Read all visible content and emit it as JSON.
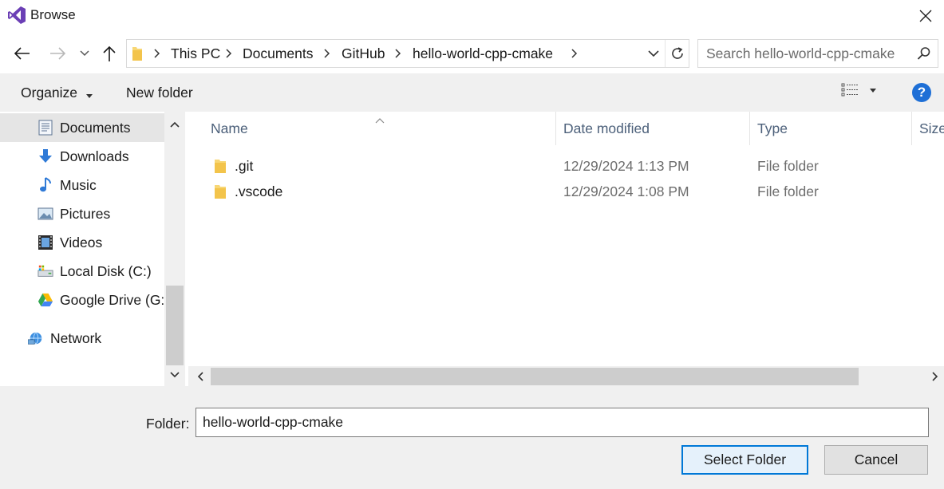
{
  "window": {
    "title": "Browse",
    "icon": "visual-studio-icon"
  },
  "address": {
    "crumbs": [
      "This PC",
      "Documents",
      "GitHub",
      "hello-world-cpp-cmake"
    ]
  },
  "search": {
    "placeholder": "Search hello-world-cpp-cmake"
  },
  "toolbar": {
    "organize_label": "Organize",
    "new_folder_label": "New folder",
    "help_label": "?"
  },
  "nav": {
    "items": [
      {
        "label": "Documents",
        "icon": "documents-icon"
      },
      {
        "label": "Downloads",
        "icon": "downloads-icon"
      },
      {
        "label": "Music",
        "icon": "music-icon"
      },
      {
        "label": "Pictures",
        "icon": "pictures-icon"
      },
      {
        "label": "Videos",
        "icon": "videos-icon"
      },
      {
        "label": "Local Disk (C:)",
        "icon": "local-disk-icon"
      },
      {
        "label": "Google Drive (G:",
        "icon": "google-drive-icon"
      },
      {
        "label": "Network",
        "icon": "network-icon"
      }
    ]
  },
  "list": {
    "columns": {
      "name": "Name",
      "date": "Date modified",
      "type": "Type",
      "size": "Size"
    },
    "rows": [
      {
        "name": ".git",
        "date": "12/29/2024 1:13 PM",
        "type": "File folder"
      },
      {
        "name": ".vscode",
        "date": "12/29/2024 1:08 PM",
        "type": "File folder"
      }
    ]
  },
  "footer": {
    "folder_label": "Folder:",
    "folder_value": "hello-world-cpp-cmake",
    "select_label": "Select Folder",
    "cancel_label": "Cancel"
  },
  "colors": {
    "accent": "#0078d7",
    "folder": "#f8d775",
    "help": "#1e6fd6"
  }
}
